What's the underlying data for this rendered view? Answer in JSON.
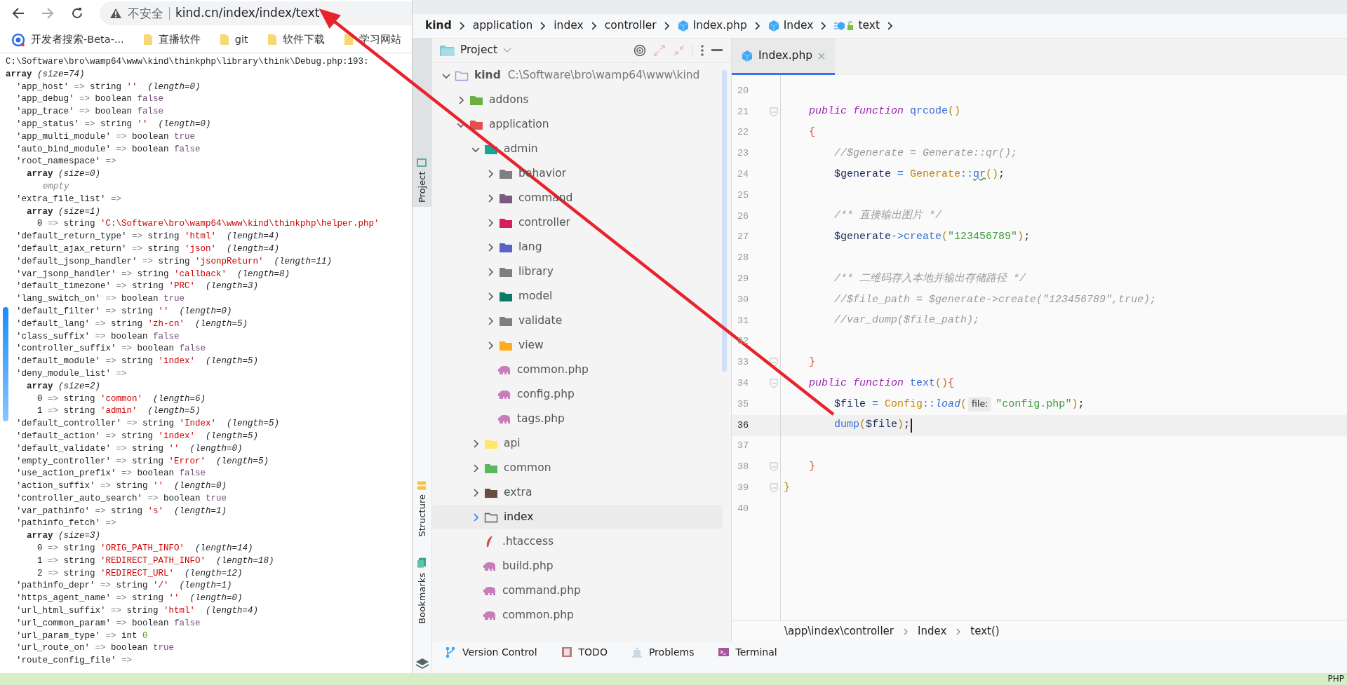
{
  "browser": {
    "address_bar": {
      "security": "不安全",
      "url": "kind.cn/index/index/text"
    },
    "bookmarks": [
      {
        "kind": "site",
        "label": "开发者搜索-Beta-..."
      },
      {
        "kind": "folder",
        "label": "直播软件"
      },
      {
        "kind": "folder",
        "label": "git"
      },
      {
        "kind": "folder",
        "label": "软件下载"
      },
      {
        "kind": "folder",
        "label": "学习网站"
      }
    ],
    "dump": {
      "header": "C:\\Software\\bro\\wamp64\\www\\kind\\thinkphp\\library\\think\\Debug.php:193:",
      "root": {
        "kind": "array",
        "type": "array",
        "note": "(size=74)",
        "children": [
          {
            "kind": "string",
            "key": "'app_host'",
            "sep": "=>",
            "type": "string",
            "value": "''",
            "note": "(length=0)"
          },
          {
            "kind": "boolean",
            "key": "'app_debug'",
            "sep": "=>",
            "type": "boolean",
            "value": "false"
          },
          {
            "kind": "boolean",
            "key": "'app_trace'",
            "sep": "=>",
            "type": "boolean",
            "value": "false"
          },
          {
            "kind": "string",
            "key": "'app_status'",
            "sep": "=>",
            "type": "string",
            "value": "''",
            "note": "(length=0)"
          },
          {
            "kind": "boolean",
            "key": "'app_multi_module'",
            "sep": "=>",
            "type": "boolean",
            "value": "true"
          },
          {
            "kind": "boolean",
            "key": "'auto_bind_module'",
            "sep": "=>",
            "type": "boolean",
            "value": "false"
          },
          {
            "kind": "nested",
            "key": "'root_namespace'",
            "sep": "=>",
            "children": [
              {
                "kind": "array",
                "type": "array",
                "note": "(size=0)",
                "children": [
                  {
                    "kind": "empty",
                    "text": "empty"
                  }
                ]
              }
            ]
          },
          {
            "kind": "nested",
            "key": "'extra_file_list'",
            "sep": "=>",
            "children": [
              {
                "kind": "array",
                "type": "array",
                "note": "(size=1)",
                "children": [
                  {
                    "kind": "string",
                    "key": "0",
                    "sep": "=>",
                    "type": "string",
                    "value": "'C:\\Software\\bro\\wamp64\\www\\kind\\thinkphp\\helper.php'"
                  }
                ]
              }
            ]
          },
          {
            "kind": "string",
            "key": "'default_return_type'",
            "sep": "=>",
            "type": "string",
            "value": "'html'",
            "note": "(length=4)"
          },
          {
            "kind": "string",
            "key": "'default_ajax_return'",
            "sep": "=>",
            "type": "string",
            "value": "'json'",
            "note": "(length=4)"
          },
          {
            "kind": "string",
            "key": "'default_jsonp_handler'",
            "sep": "=>",
            "type": "string",
            "value": "'jsonpReturn'",
            "note": "(length=11)"
          },
          {
            "kind": "string",
            "key": "'var_jsonp_handler'",
            "sep": "=>",
            "type": "string",
            "value": "'callback'",
            "note": "(length=8)"
          },
          {
            "kind": "string",
            "key": "'default_timezone'",
            "sep": "=>",
            "type": "string",
            "value": "'PRC'",
            "note": "(length=3)"
          },
          {
            "kind": "boolean",
            "key": "'lang_switch_on'",
            "sep": "=>",
            "type": "boolean",
            "value": "true"
          },
          {
            "kind": "string",
            "key": "'default_filter'",
            "sep": "=>",
            "type": "string",
            "value": "''",
            "note": "(length=0)"
          },
          {
            "kind": "string",
            "key": "'default_lang'",
            "sep": "=>",
            "type": "string",
            "value": "'zh-cn'",
            "note": "(length=5)"
          },
          {
            "kind": "boolean",
            "key": "'class_suffix'",
            "sep": "=>",
            "type": "boolean",
            "value": "false"
          },
          {
            "kind": "boolean",
            "key": "'controller_suffix'",
            "sep": "=>",
            "type": "boolean",
            "value": "false"
          },
          {
            "kind": "string",
            "key": "'default_module'",
            "sep": "=>",
            "type": "string",
            "value": "'index'",
            "note": "(length=5)"
          },
          {
            "kind": "nested",
            "key": "'deny_module_list'",
            "sep": "=>",
            "children": [
              {
                "kind": "array",
                "type": "array",
                "note": "(size=2)",
                "children": [
                  {
                    "kind": "string",
                    "key": "0",
                    "sep": "=>",
                    "type": "string",
                    "value": "'common'",
                    "note": "(length=6)"
                  },
                  {
                    "kind": "string",
                    "key": "1",
                    "sep": "=>",
                    "type": "string",
                    "value": "'admin'",
                    "note": "(length=5)"
                  }
                ]
              }
            ]
          },
          {
            "kind": "string",
            "key": "'default_controller'",
            "sep": "=>",
            "type": "string",
            "value": "'Index'",
            "note": "(length=5)"
          },
          {
            "kind": "string",
            "key": "'default_action'",
            "sep": "=>",
            "type": "string",
            "value": "'index'",
            "note": "(length=5)"
          },
          {
            "kind": "string",
            "key": "'default_validate'",
            "sep": "=>",
            "type": "string",
            "value": "''",
            "note": "(length=0)"
          },
          {
            "kind": "string",
            "key": "'empty_controller'",
            "sep": "=>",
            "type": "string",
            "value": "'Error'",
            "note": "(length=5)"
          },
          {
            "kind": "boolean",
            "key": "'use_action_prefix'",
            "sep": "=>",
            "type": "boolean",
            "value": "false"
          },
          {
            "kind": "string",
            "key": "'action_suffix'",
            "sep": "=>",
            "type": "string",
            "value": "''",
            "note": "(length=0)"
          },
          {
            "kind": "boolean",
            "key": "'controller_auto_search'",
            "sep": "=>",
            "type": "boolean",
            "value": "true"
          },
          {
            "kind": "string",
            "key": "'var_pathinfo'",
            "sep": "=>",
            "type": "string",
            "value": "'s'",
            "note": "(length=1)"
          },
          {
            "kind": "nested",
            "key": "'pathinfo_fetch'",
            "sep": "=>",
            "children": [
              {
                "kind": "array",
                "type": "array",
                "note": "(size=3)",
                "children": [
                  {
                    "kind": "string",
                    "key": "0",
                    "sep": "=>",
                    "type": "string",
                    "value": "'ORIG_PATH_INFO'",
                    "note": "(length=14)"
                  },
                  {
                    "kind": "string",
                    "key": "1",
                    "sep": "=>",
                    "type": "string",
                    "value": "'REDIRECT_PATH_INFO'",
                    "note": "(length=18)"
                  },
                  {
                    "kind": "string",
                    "key": "2",
                    "sep": "=>",
                    "type": "string",
                    "value": "'REDIRECT_URL'",
                    "note": "(length=12)"
                  }
                ]
              }
            ]
          },
          {
            "kind": "string",
            "key": "'pathinfo_depr'",
            "sep": "=>",
            "type": "string",
            "value": "'/'",
            "note": "(length=1)"
          },
          {
            "kind": "string",
            "key": "'https_agent_name'",
            "sep": "=>",
            "type": "string",
            "value": "''",
            "note": "(length=0)"
          },
          {
            "kind": "string",
            "key": "'url_html_suffix'",
            "sep": "=>",
            "type": "string",
            "value": "'html'",
            "note": "(length=4)"
          },
          {
            "kind": "boolean",
            "key": "'url_common_param'",
            "sep": "=>",
            "type": "boolean",
            "value": "false"
          },
          {
            "kind": "int",
            "key": "'url_param_type'",
            "sep": "=>",
            "type": "int",
            "value": "0"
          },
          {
            "kind": "boolean",
            "key": "'url_route_on'",
            "sep": "=>",
            "type": "boolean",
            "value": "true"
          },
          {
            "kind": "nested",
            "key": "'route_config_file'",
            "sep": "=>"
          }
        ]
      }
    }
  },
  "ide": {
    "breadcrumb": [
      {
        "kind": "project",
        "label": "kind"
      },
      {
        "kind": "folder",
        "label": "application"
      },
      {
        "kind": "folder",
        "label": "index"
      },
      {
        "kind": "folder",
        "label": "controller"
      },
      {
        "kind": "php-class",
        "label": "Index.php"
      },
      {
        "kind": "class",
        "label": "Index"
      },
      {
        "kind": "method",
        "label": "text"
      }
    ],
    "side_tools": [
      {
        "kind": "project",
        "label": "Project",
        "selected": true
      },
      {
        "kind": "structure",
        "label": "Structure",
        "selected": false
      },
      {
        "kind": "bookmarks",
        "label": "Bookmarks",
        "selected": false
      }
    ],
    "project_panel": {
      "title": "Project",
      "tree": [
        {
          "kind": "root",
          "label": "kind",
          "path": "C:\\Software\\bro\\wamp64\\www\\kind",
          "expanded": true,
          "selected": false,
          "children": [
            {
              "kind": "folder",
              "label": "addons",
              "color": "#6bb13f",
              "expanded": false,
              "selected": false
            },
            {
              "kind": "folder",
              "label": "application",
              "color": "#e5504f",
              "expanded": true,
              "selected": false,
              "children": [
                {
                  "kind": "folder",
                  "label": "admin",
                  "color": "#15a89a",
                  "expanded": true,
                  "selected": false,
                  "children": [
                    {
                      "kind": "folder",
                      "label": "behavior",
                      "color": "#7f7f7f",
                      "expanded": false,
                      "selected": false
                    },
                    {
                      "kind": "folder",
                      "label": "command",
                      "color": "#7a5a7e",
                      "expanded": false,
                      "selected": false
                    },
                    {
                      "kind": "folder",
                      "label": "controller",
                      "color": "#d61f5a",
                      "expanded": false,
                      "selected": false
                    },
                    {
                      "kind": "folder",
                      "label": "lang",
                      "color": "#5b63c9",
                      "expanded": false,
                      "selected": false
                    },
                    {
                      "kind": "folder",
                      "label": "library",
                      "color": "#7f7f7f",
                      "expanded": false,
                      "selected": false
                    },
                    {
                      "kind": "folder",
                      "label": "model",
                      "color": "#0b7a64",
                      "expanded": false,
                      "selected": false
                    },
                    {
                      "kind": "folder",
                      "label": "validate",
                      "color": "#7f7f7f",
                      "expanded": false,
                      "selected": false
                    },
                    {
                      "kind": "folder",
                      "label": "view",
                      "color": "#ffac1c",
                      "expanded": false,
                      "selected": false
                    },
                    {
                      "kind": "php",
                      "label": "common.php",
                      "selected": false
                    },
                    {
                      "kind": "php",
                      "label": "config.php",
                      "selected": false
                    },
                    {
                      "kind": "php",
                      "label": "tags.php",
                      "selected": false
                    }
                  ]
                },
                {
                  "kind": "folder",
                  "label": "api",
                  "color": "#ffe768",
                  "expanded": false,
                  "selected": false
                },
                {
                  "kind": "folder",
                  "label": "common",
                  "color": "#5cb85c",
                  "expanded": false,
                  "selected": false
                },
                {
                  "kind": "folder",
                  "label": "extra",
                  "color": "#6d4c41",
                  "expanded": false,
                  "selected": false
                },
                {
                  "kind": "plain-folder",
                  "label": "index",
                  "expanded": false,
                  "selected": true
                },
                {
                  "kind": "htaccess",
                  "label": ".htaccess",
                  "selected": false
                },
                {
                  "kind": "php",
                  "label": "build.php",
                  "selected": false
                },
                {
                  "kind": "php",
                  "label": "command.php",
                  "selected": false
                },
                {
                  "kind": "php",
                  "label": "common.php",
                  "selected": false
                }
              ]
            }
          ]
        }
      ]
    },
    "editor": {
      "tabs": [
        {
          "label": "Index.php",
          "selected": true
        }
      ],
      "lines": [
        {
          "number": "20",
          "fold": false,
          "current": false
        },
        {
          "number": "21",
          "fold": true,
          "current": false,
          "tokens": [
            {
              "kind": "kw",
              "text": "    public function "
            },
            {
              "kind": "fn",
              "text": "qrcode"
            },
            {
              "kind": "paren",
              "text": "()"
            }
          ]
        },
        {
          "number": "22",
          "fold": false,
          "current": false,
          "tokens": [
            {
              "kind": "brace",
              "text": "    {"
            }
          ]
        },
        {
          "number": "23",
          "fold": false,
          "current": false,
          "tokens": [
            {
              "kind": "comment",
              "text": "        //$generate = Generate::qr();"
            }
          ]
        },
        {
          "number": "24",
          "fold": false,
          "current": false,
          "tokens": [
            {
              "kind": "var",
              "text": "        $generate "
            },
            {
              "kind": "op",
              "text": "= "
            },
            {
              "kind": "cls",
              "text": "Generate"
            },
            {
              "kind": "op",
              "text": "::"
            },
            {
              "kind": "warn",
              "text": "qr"
            },
            {
              "kind": "paren",
              "text": "()"
            },
            {
              "kind": "plain",
              "text": ";"
            }
          ]
        },
        {
          "number": "25",
          "fold": false,
          "current": false
        },
        {
          "number": "26",
          "fold": false,
          "current": false,
          "tokens": [
            {
              "kind": "comment",
              "text": "        /** 直接输出图片 */"
            }
          ]
        },
        {
          "number": "27",
          "fold": false,
          "current": false,
          "tokens": [
            {
              "kind": "var",
              "text": "        $generate"
            },
            {
              "kind": "op",
              "text": "->"
            },
            {
              "kind": "fn",
              "text": "create"
            },
            {
              "kind": "paren",
              "text": "("
            },
            {
              "kind": "str",
              "text": "\"123456789\""
            },
            {
              "kind": "paren",
              "text": ")"
            },
            {
              "kind": "plain",
              "text": ";"
            }
          ]
        },
        {
          "number": "28",
          "fold": false,
          "current": false
        },
        {
          "number": "29",
          "fold": false,
          "current": false,
          "tokens": [
            {
              "kind": "comment",
              "text": "        /** 二维码存入本地并输出存储路径 */"
            }
          ]
        },
        {
          "number": "30",
          "fold": false,
          "current": false,
          "tokens": [
            {
              "kind": "comment",
              "text": "        //$file_path = $generate->create(\"123456789\",true);"
            }
          ]
        },
        {
          "number": "31",
          "fold": false,
          "current": false,
          "tokens": [
            {
              "kind": "comment",
              "text": "        //var_dump($file_path);"
            }
          ]
        },
        {
          "number": "32",
          "fold": false,
          "current": false
        },
        {
          "number": "33",
          "fold": true,
          "current": false,
          "tokens": [
            {
              "kind": "brace",
              "text": "    }"
            }
          ]
        },
        {
          "number": "34",
          "fold": true,
          "current": false,
          "tokens": [
            {
              "kind": "kw",
              "text": "    public function "
            },
            {
              "kind": "fn",
              "text": "text"
            },
            {
              "kind": "paren",
              "text": "()"
            },
            {
              "kind": "brace",
              "text": "{"
            }
          ]
        },
        {
          "number": "35",
          "fold": false,
          "current": false,
          "tokens": [
            {
              "kind": "var",
              "text": "        $file "
            },
            {
              "kind": "op",
              "text": "= "
            },
            {
              "kind": "cls",
              "text": "Config"
            },
            {
              "kind": "op",
              "text": "::"
            },
            {
              "kind": "static",
              "text": "load"
            },
            {
              "kind": "paren",
              "text": "("
            },
            {
              "kind": "hint",
              "text": "file:"
            },
            {
              "kind": "str",
              "text": "\"config.php\""
            },
            {
              "kind": "paren",
              "text": ")"
            },
            {
              "kind": "plain",
              "text": ";"
            }
          ]
        },
        {
          "number": "36",
          "fold": false,
          "current": true,
          "tokens": [
            {
              "kind": "fn",
              "text": "        dump"
            },
            {
              "kind": "paren",
              "text": "("
            },
            {
              "kind": "var",
              "text": "$file"
            },
            {
              "kind": "paren",
              "text": ")"
            },
            {
              "kind": "plain",
              "text": ";"
            }
          ]
        },
        {
          "number": "37",
          "fold": false,
          "current": false
        },
        {
          "number": "38",
          "fold": true,
          "current": false,
          "tokens": [
            {
              "kind": "brace",
              "text": "    }"
            }
          ]
        },
        {
          "number": "39",
          "fold": true,
          "current": false,
          "tokens": [
            {
              "kind": "paren",
              "text": "}"
            }
          ]
        },
        {
          "number": "40",
          "fold": false,
          "current": false
        }
      ],
      "footer_path": [
        "\\app\\index\\controller",
        "Index",
        "text()"
      ]
    },
    "tool_windows": [
      {
        "kind": "vcs",
        "label": "Version Control"
      },
      {
        "kind": "todo",
        "label": "TODO"
      },
      {
        "kind": "problems",
        "label": "Problems"
      },
      {
        "kind": "terminal",
        "label": "Terminal"
      }
    ],
    "status": {
      "language": "PHP"
    }
  }
}
